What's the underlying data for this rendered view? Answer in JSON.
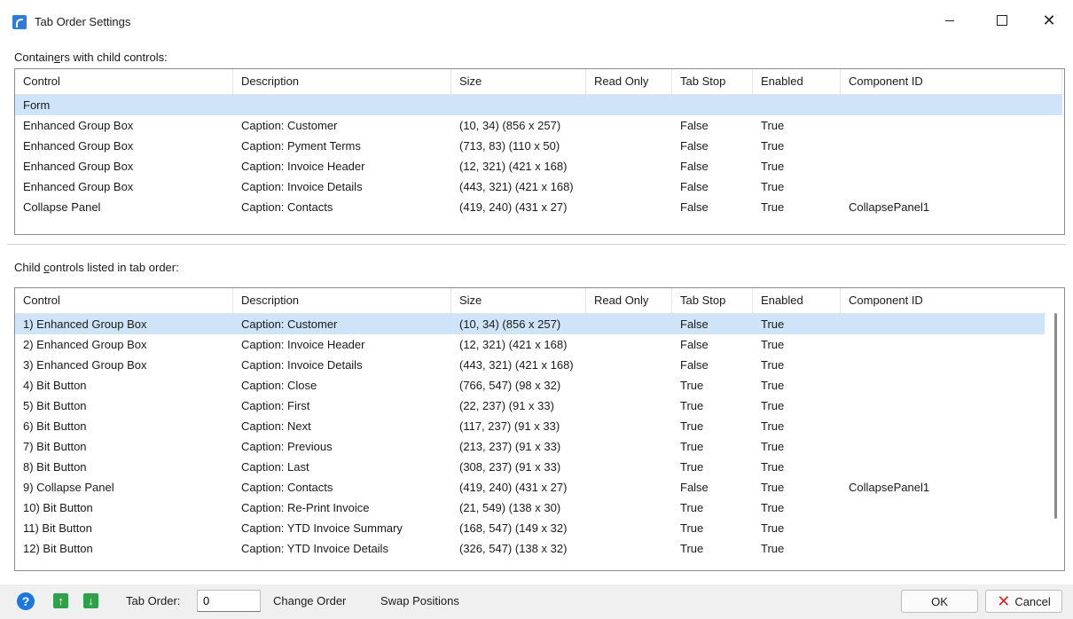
{
  "window": {
    "title": "Tab Order Settings",
    "min_glyph": "",
    "max_glyph": "",
    "close_glyph": "✕"
  },
  "containers": {
    "label_pre": "Contain",
    "label_u": "e",
    "label_post": "rs with child controls:",
    "columns": [
      "Control",
      "Description",
      "Size",
      "Read Only",
      "Tab Stop",
      "Enabled",
      "Component ID"
    ],
    "rows": [
      {
        "control": "Form",
        "description": "",
        "size": "",
        "read_only": "",
        "tab_stop": "",
        "enabled": "",
        "component_id": "",
        "selected": true
      },
      {
        "control": "Enhanced Group Box",
        "description": "Caption: Customer",
        "size": "(10, 34) (856 x 257)",
        "read_only": "",
        "tab_stop": "False",
        "enabled": "True",
        "component_id": ""
      },
      {
        "control": "Enhanced Group Box",
        "description": "Caption: Pyment Terms",
        "size": "(713, 83) (110 x 50)",
        "read_only": "",
        "tab_stop": "False",
        "enabled": "True",
        "component_id": ""
      },
      {
        "control": "Enhanced Group Box",
        "description": "Caption: Invoice Header",
        "size": "(12, 321) (421 x 168)",
        "read_only": "",
        "tab_stop": "False",
        "enabled": "True",
        "component_id": ""
      },
      {
        "control": "Enhanced Group Box",
        "description": "Caption: Invoice Details",
        "size": "(443, 321) (421 x 168)",
        "read_only": "",
        "tab_stop": "False",
        "enabled": "True",
        "component_id": ""
      },
      {
        "control": "Collapse Panel",
        "description": "Caption: Contacts",
        "size": "(419, 240) (431 x 27)",
        "read_only": "",
        "tab_stop": "False",
        "enabled": "True",
        "component_id": "CollapsePanel1"
      }
    ]
  },
  "children": {
    "label_pre": "Child ",
    "label_u": "c",
    "label_post": "ontrols listed in tab order:",
    "columns": [
      "Control",
      "Description",
      "Size",
      "Read Only",
      "Tab Stop",
      "Enabled",
      "Component ID"
    ],
    "rows": [
      {
        "control": "1) Enhanced Group Box",
        "description": "Caption: Customer",
        "size": "(10, 34) (856 x 257)",
        "read_only": "",
        "tab_stop": "False",
        "enabled": "True",
        "component_id": "",
        "selected": true
      },
      {
        "control": "2) Enhanced Group Box",
        "description": "Caption: Invoice Header",
        "size": "(12, 321) (421 x 168)",
        "read_only": "",
        "tab_stop": "False",
        "enabled": "True",
        "component_id": ""
      },
      {
        "control": "3) Enhanced Group Box",
        "description": "Caption: Invoice Details",
        "size": "(443, 321) (421 x 168)",
        "read_only": "",
        "tab_stop": "False",
        "enabled": "True",
        "component_id": ""
      },
      {
        "control": "4) Bit Button",
        "description": "Caption: Close",
        "size": "(766, 547) (98 x 32)",
        "read_only": "",
        "tab_stop": "True",
        "enabled": "True",
        "component_id": ""
      },
      {
        "control": "5) Bit Button",
        "description": "Caption: First",
        "size": "(22, 237) (91 x 33)",
        "read_only": "",
        "tab_stop": "True",
        "enabled": "True",
        "component_id": ""
      },
      {
        "control": "6) Bit Button",
        "description": "Caption: Next",
        "size": "(117, 237) (91 x 33)",
        "read_only": "",
        "tab_stop": "True",
        "enabled": "True",
        "component_id": ""
      },
      {
        "control": "7) Bit Button",
        "description": "Caption: Previous",
        "size": "(213, 237) (91 x 33)",
        "read_only": "",
        "tab_stop": "True",
        "enabled": "True",
        "component_id": ""
      },
      {
        "control": "8) Bit Button",
        "description": "Caption: Last",
        "size": "(308, 237) (91 x 33)",
        "read_only": "",
        "tab_stop": "True",
        "enabled": "True",
        "component_id": ""
      },
      {
        "control": "9) Collapse Panel",
        "description": "Caption: Contacts",
        "size": "(419, 240) (431 x 27)",
        "read_only": "",
        "tab_stop": "False",
        "enabled": "True",
        "component_id": "CollapsePanel1"
      },
      {
        "control": "10) Bit Button",
        "description": "Caption: Re-Print Invoice",
        "size": "(21, 549) (138 x 30)",
        "read_only": "",
        "tab_stop": "True",
        "enabled": "True",
        "component_id": ""
      },
      {
        "control": "11) Bit Button",
        "description": "Caption: YTD Invoice Summary",
        "size": "(168, 547) (149 x 32)",
        "read_only": "",
        "tab_stop": "True",
        "enabled": "True",
        "component_id": ""
      },
      {
        "control": "12) Bit Button",
        "description": "Caption: YTD Invoice Details",
        "size": "(326, 547) (138 x 32)",
        "read_only": "",
        "tab_stop": "True",
        "enabled": "True",
        "component_id": ""
      }
    ]
  },
  "toolbar": {
    "help_glyph": "?",
    "up_glyph": "↑",
    "down_glyph": "↓",
    "tab_order_label": "Tab Order:",
    "tab_order_value": "0",
    "change_order_label": "Change Order",
    "swap_positions_label": "Swap Positions",
    "ok_label": "OK",
    "cancel_glyph": "✕",
    "cancel_label": "Cancel"
  },
  "colors": {
    "selected_row": "#cfe4f8",
    "bottom_bar": "#f0f0f0",
    "help_icon": "#1e78d7",
    "arrow_icon": "#2ea14a",
    "cancel_icon": "#d4262b"
  }
}
